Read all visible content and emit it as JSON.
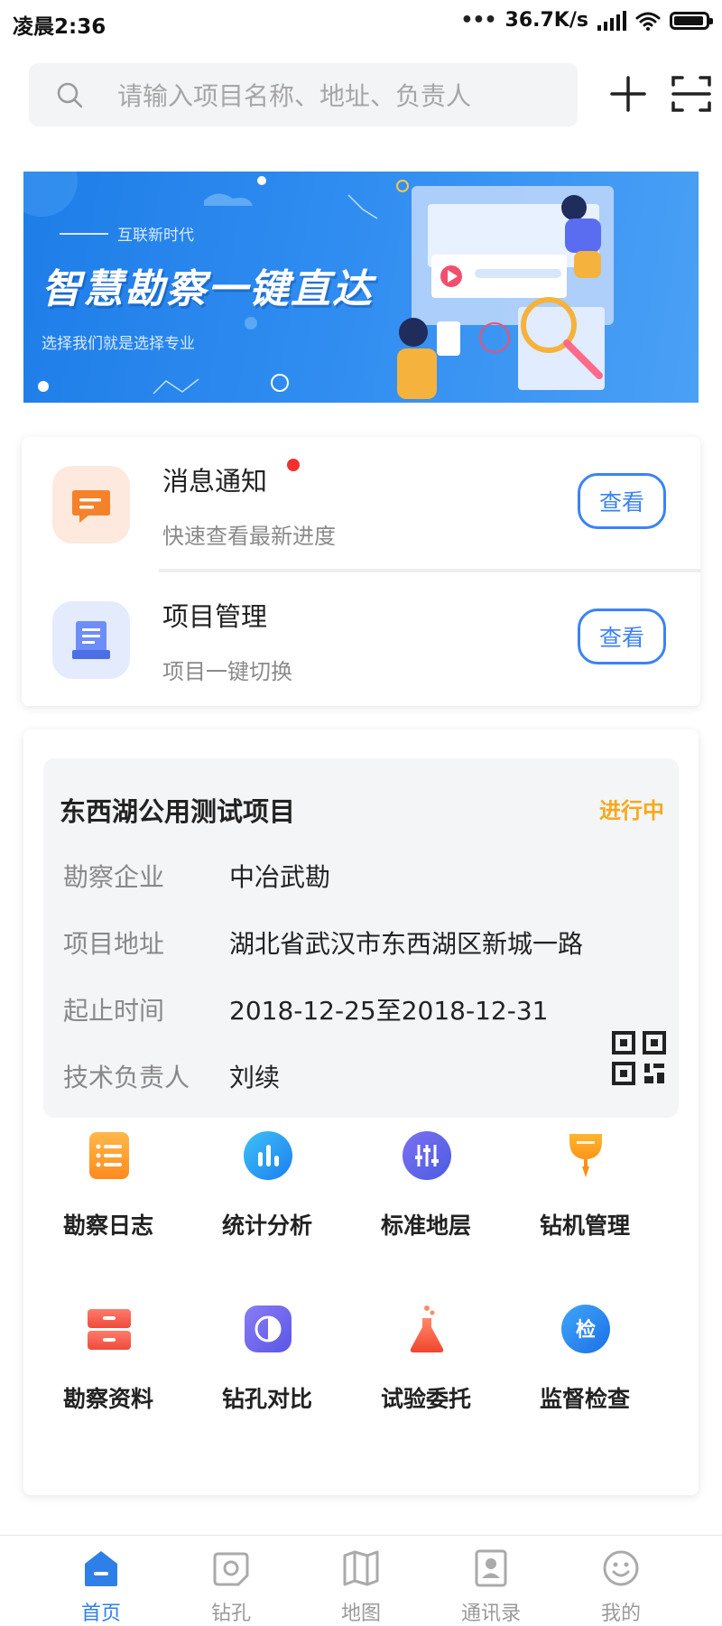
{
  "status_bar": {
    "time": "凌晨2:36",
    "net_speed": "36.7K/s",
    "icons": [
      "dots-icon",
      "signal-icon",
      "wifi-icon",
      "battery-icon"
    ]
  },
  "search": {
    "placeholder": "请输入项目名称、地址、负责人",
    "icon": "search-icon"
  },
  "header_actions": [
    "add-icon",
    "scan-icon"
  ],
  "banner": {
    "tagline": "互联新时代",
    "title": "智慧勘察一键直达",
    "subtitle": "选择我们就是选择专业"
  },
  "quick_entries": [
    {
      "title": "消息通知",
      "subtitle": "快速查看最新进度",
      "button": "查看",
      "icon": "message-icon",
      "has_unread": true
    },
    {
      "title": "项目管理",
      "subtitle": "项目一键切换",
      "button": "查看",
      "icon": "project-icon",
      "has_unread": false
    }
  ],
  "project": {
    "name": "东西湖公用测试项目",
    "status": "进行中",
    "fields": [
      {
        "label": "勘察企业",
        "value": "中冶武勘"
      },
      {
        "label": "项目地址",
        "value": "湖北省武汉市东西湖区新城一路"
      },
      {
        "label": "起止时间",
        "value": "2018-12-25至2018-12-31"
      },
      {
        "label": "技术负责人",
        "value": "刘续"
      }
    ]
  },
  "functions": [
    {
      "label": "勘察日志",
      "icon": "log-icon"
    },
    {
      "label": "统计分析",
      "icon": "stats-icon"
    },
    {
      "label": "标准地层",
      "icon": "stratum-icon"
    },
    {
      "label": "钻机管理",
      "icon": "drill-rig-icon"
    },
    {
      "label": "勘察资料",
      "icon": "archive-icon"
    },
    {
      "label": "钻孔对比",
      "icon": "compare-icon"
    },
    {
      "label": "试验委托",
      "icon": "flask-icon"
    },
    {
      "label": "监督检查",
      "icon": "inspect-icon"
    }
  ],
  "tabs": [
    {
      "label": "首页",
      "icon": "home-icon",
      "active": true
    },
    {
      "label": "钻孔",
      "icon": "borehole-icon",
      "active": false
    },
    {
      "label": "地图",
      "icon": "map-icon",
      "active": false
    },
    {
      "label": "通讯录",
      "icon": "contacts-icon",
      "active": false
    },
    {
      "label": "我的",
      "icon": "profile-icon",
      "active": false
    }
  ],
  "colors": {
    "primary": "#2f7fe8",
    "status_in_progress": "#f7a81b",
    "unread_dot": "#f23030"
  }
}
